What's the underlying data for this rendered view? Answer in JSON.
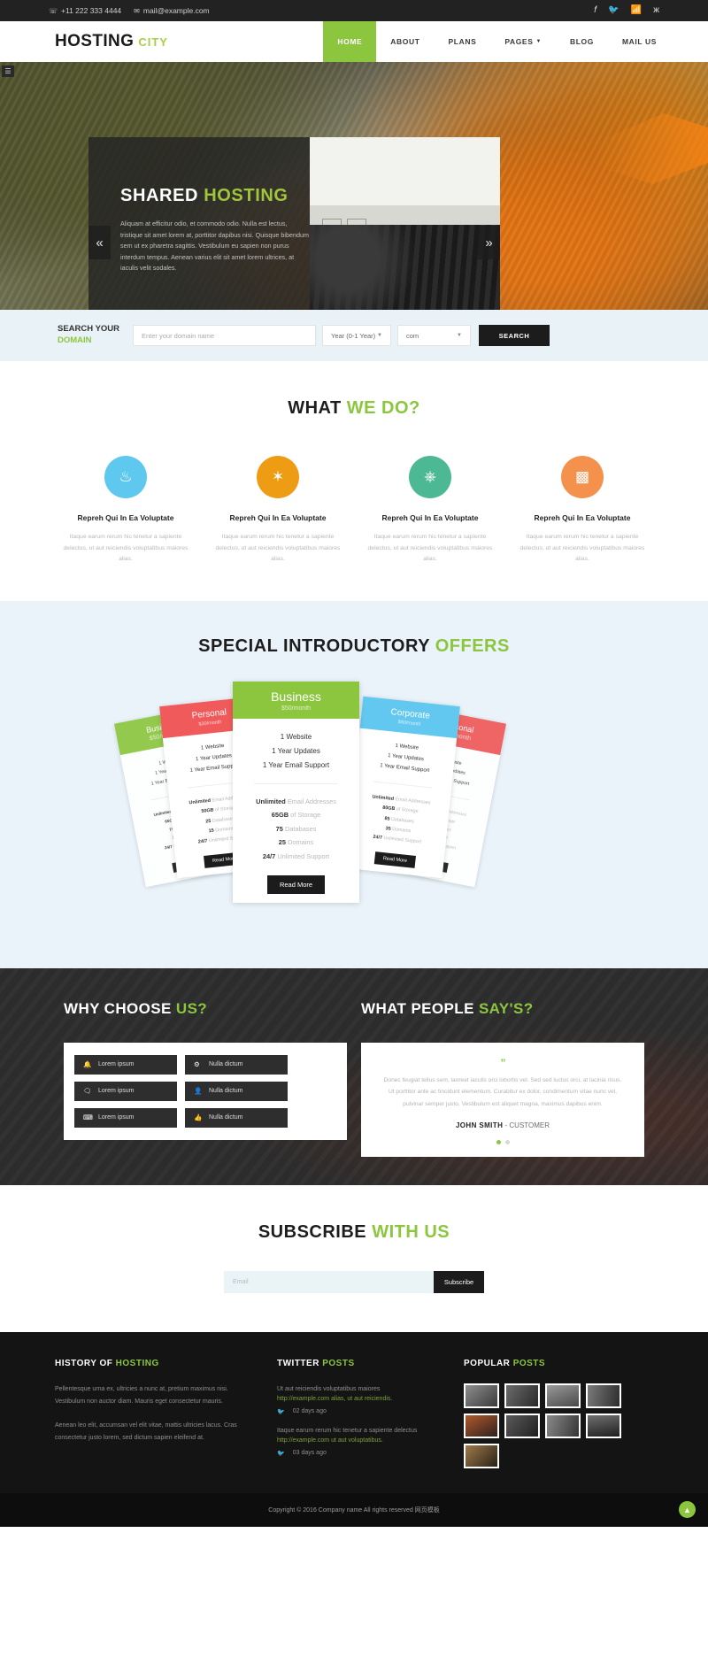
{
  "topbar": {
    "phone": "+11 222 333 4444",
    "email": "mail@example.com",
    "phone_icon": "phone-icon",
    "email_icon": "envelope-icon",
    "socials": [
      {
        "name": "facebook-icon",
        "glyph": "f"
      },
      {
        "name": "twitter-icon",
        "glyph": "ᵛ"
      },
      {
        "name": "rss-icon",
        "glyph": "≈"
      },
      {
        "name": "vk-icon",
        "glyph": "ж"
      }
    ]
  },
  "header": {
    "logo_main": "HOSTING",
    "logo_accent": "CITY",
    "nav": [
      {
        "label": "HOME",
        "active": true
      },
      {
        "label": "ABOUT",
        "active": false
      },
      {
        "label": "PLANS",
        "active": false
      },
      {
        "label": "PAGES",
        "active": false,
        "caret": true
      },
      {
        "label": "BLOG",
        "active": false
      },
      {
        "label": "MAIL US",
        "active": false
      }
    ]
  },
  "hero": {
    "title_main": "SHARED",
    "title_accent": "HOSTING",
    "paragraph": "Aliquam at efficitur odio, et commodo odio. Nulla est lectus, tristique sit amet lorem at, porttitor dapibus nisi. Quisque bibendum sem ut ex pharetra sagittis. Vestibulum eu sapien non purus interdum tempus. Aenean varius elit sit amet lorem ultrices, at iaculis velit sodales.",
    "prev_label": "«",
    "next_label": "»",
    "dots": 3,
    "active_dot": 3
  },
  "domain_search": {
    "label_line1": "SEARCH YOUR",
    "label_line2": "DOMAIN",
    "input_placeholder": "Enter your domain name",
    "year_selected": "Year (0-1 Year)",
    "tld_selected": "com",
    "button": "SEARCH"
  },
  "what_we_do": {
    "title_main": "WHAT",
    "title_accent": "WE DO?",
    "features": [
      {
        "icon": "anchor-icon",
        "glyph": "⚓",
        "color": "#5ec8ee",
        "heading": "Repreh Qui In Ea Voluptate",
        "text": "Itaque earum rerum hic tenetur a sapiente delectus, ut aut reiciendis voluptatibus maiores alias."
      },
      {
        "icon": "gear-icon",
        "glyph": "⚙",
        "color": "#ee9c14",
        "heading": "Repreh Qui In Ea Voluptate",
        "text": "Itaque earum rerum hic tenetur a sapiente delectus, ut aut reiciendis voluptatibus maiores alias."
      },
      {
        "icon": "power-icon",
        "glyph": "⏻",
        "color": "#4cb894",
        "heading": "Repreh Qui In Ea Voluptate",
        "text": "Itaque earum rerum hic tenetur a sapiente delectus, ut aut reiciendis voluptatibus maiores alias."
      },
      {
        "icon": "bar-chart-icon",
        "glyph": "ᵜ",
        "color": "#f3914d",
        "heading": "Repreh Qui In Ea Voluptate",
        "text": "Itaque earum rerum hic tenetur a sapiente delectus, ut aut reiciendis voluptatibus maiores alias."
      }
    ]
  },
  "offers": {
    "title_main": "SPECIAL INTRODUCTORY",
    "title_accent": "OFFERS",
    "plans": [
      {
        "id": "card-l1",
        "name": "Business",
        "price": "$50/month",
        "color": "#8cc63e",
        "top": [
          "1 Website",
          "1 Year Updates",
          "1 Year Email Support"
        ],
        "specs": [
          [
            "Unlimited",
            "Email Addresses"
          ],
          [
            "65GB",
            "of Storage"
          ],
          [
            "75",
            "Databases"
          ],
          [
            "25",
            "Domains"
          ],
          [
            "24/7",
            "Unlimited Support"
          ]
        ],
        "button": "Read More"
      },
      {
        "id": "card-l2",
        "name": "Personal",
        "price": "$30/month",
        "color": "#f05a5a",
        "top": [
          "1 Website",
          "1 Year Updates",
          "1 Year Email Support"
        ],
        "specs": [
          [
            "Unlimited",
            "Email Addresses"
          ],
          [
            "50GB",
            "of Storage"
          ],
          [
            "25",
            "Databases"
          ],
          [
            "15",
            "Domains"
          ],
          [
            "24/7",
            "Unlimited Support"
          ]
        ],
        "button": "Read More"
      },
      {
        "id": "card-center",
        "name": "Business",
        "price": "$50/month",
        "color": "#8cc63e",
        "top": [
          "1 Website",
          "1 Year Updates",
          "1 Year Email Support"
        ],
        "specs": [
          [
            "Unlimited",
            "Email Addresses"
          ],
          [
            "65GB",
            "of Storage"
          ],
          [
            "75",
            "Databases"
          ],
          [
            "25",
            "Domains"
          ],
          [
            "24/7",
            "Unlimited Support"
          ]
        ],
        "button": "Read More"
      },
      {
        "id": "card-r2",
        "name": "Corporate",
        "price": "$80/month",
        "color": "#62c8ef",
        "top": [
          "1 Website",
          "1 Year Updates",
          "1 Year Email Support"
        ],
        "specs": [
          [
            "Unlimited",
            "Email Addresses"
          ],
          [
            "80GB",
            "of Storage"
          ],
          [
            "85",
            "Databases"
          ],
          [
            "35",
            "Domains"
          ],
          [
            "24/7",
            "Unlimited Support"
          ]
        ],
        "button": "Read More"
      },
      {
        "id": "card-r1",
        "name": "Personal",
        "price": "$30/month",
        "color": "#f05a5a",
        "top": [
          "1 Website",
          "1 Year Updates",
          "1 Year Email Support"
        ],
        "specs": [
          [
            "Unlimited",
            "Email Addresses"
          ],
          [
            "50GB",
            "of Storage"
          ],
          [
            "25",
            "Databases"
          ],
          [
            "15",
            "Domains"
          ],
          [
            "24/7",
            "Unlimited Support"
          ]
        ],
        "button": "Read More"
      }
    ]
  },
  "why_choose": {
    "title_main": "WHY CHOOSE",
    "title_accent": "US?",
    "chips": [
      {
        "icon": "bell-icon",
        "glyph": "▲",
        "label": "Lorem ipsum"
      },
      {
        "icon": "gear-icon",
        "glyph": "⚙",
        "label": "Nulla dictum"
      },
      {
        "icon": "comments-icon",
        "glyph": "✉",
        "label": "Lorem ipsum"
      },
      {
        "icon": "user-icon",
        "glyph": "♟",
        "label": "Nulla dictum"
      },
      {
        "icon": "keyboard-icon",
        "glyph": "⌨",
        "label": "Lorem ipsum"
      },
      {
        "icon": "thumbs-up-icon",
        "glyph": "☝",
        "label": "Nulla dictum"
      }
    ]
  },
  "testimonials": {
    "title_main": "WHAT PEOPLE",
    "title_accent": "SAY'S?",
    "quote_mark": "”",
    "text": "Donec feugiat tellus sem, laoreet iaculis orci lobortis vel. Sed sed luctus orci, at lacinia risus. Ut porttitor ante ac tincidunt elementum. Curabitur ex dolor, condimentum vitae nunc vel, pulvinar semper justo. Vestibulum est aliquet magna, maximus dapibus enim.",
    "author": "JOHN SMITH",
    "role": "- CUSTOMER",
    "dots": 2,
    "active_dot": 1
  },
  "subscribe": {
    "title_main": "SUBSCRIBE",
    "title_accent": "WITH US",
    "placeholder": "Email",
    "button": "Subscribe"
  },
  "footer": {
    "col1": {
      "head_main": "HISTORY OF",
      "head_accent": "HOSTING",
      "p1": "Pellentesque urna ex, ultricies a nunc at, pretium maximus nisi. Vestibulum non auctor diam. Mauris eget consectetur mauris.",
      "p2": "Aenean leo elit, accumsan vel elit vitae, mattis ultricies lacus. Cras consectetur justo lorem, sed dictum sapien eleifend at."
    },
    "col2": {
      "head_main": "TWITTER",
      "head_accent": "POSTS",
      "posts": [
        {
          "text": "Ut aut reiciendis voluptatibus maiores",
          "link": "http://example.com alias, ut aut reiciendis.",
          "icon": "twitter-icon",
          "ago": "02 days ago"
        },
        {
          "text": "Itaque earum rerum hic tenetur a sapiente delectus",
          "link": "http://example.com ut aut voluptatibus.",
          "icon": "twitter-icon",
          "ago": "03 days ago"
        }
      ]
    },
    "col3": {
      "head_main": "POPULAR",
      "head_accent": "POSTS",
      "thumbs": [
        "linear-gradient(140deg,#8e8e8e,#3a3a3a)",
        "linear-gradient(120deg,#6b6b6b,#2a2a2a)",
        "linear-gradient(160deg,#9a9a9a,#4a4a4a)",
        "linear-gradient(100deg,#7a7a7a,#2e2e2e)",
        "linear-gradient(150deg,#b05a2a,#302020)",
        "linear-gradient(130deg,#5a5a5a,#202020)",
        "linear-gradient(110deg,#8a8a8a,#353535)",
        "linear-gradient(170deg,#707070,#1f1f1f)",
        "linear-gradient(135deg,#a07a4a,#2a2218)"
      ]
    },
    "copyright": "Copyright © 2016 Company name All rights reserved 网页模板",
    "to_top_icon": "arrow-up-icon",
    "to_top_glyph": "▲"
  },
  "colors": {
    "accent_green": "#8cc63e",
    "dark": "#2e2e2e",
    "light_blue": "#e9f3f9"
  }
}
